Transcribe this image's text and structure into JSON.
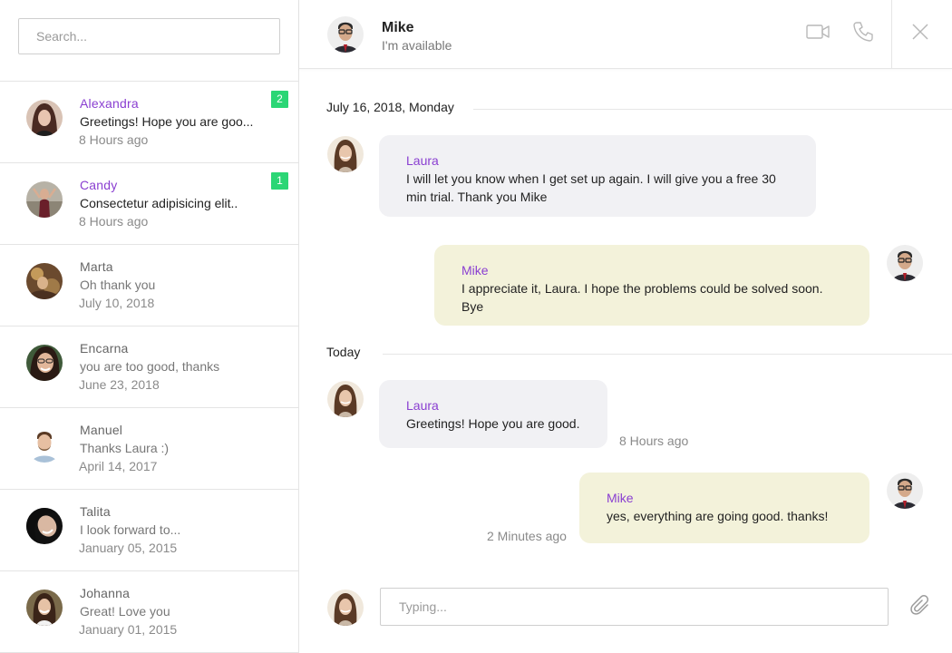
{
  "sidebar": {
    "search": {
      "placeholder": "Search..."
    },
    "contacts": [
      {
        "name": "Alexandra",
        "message": "Greetings! Hope you are goo...",
        "time": "8 Hours ago",
        "badge": "2",
        "unread": true,
        "avatar_color": "#5a3a32"
      },
      {
        "name": "Candy",
        "message": "Consectetur adipisicing elit..",
        "time": "8 Hours ago",
        "badge": "1",
        "unread": true,
        "avatar_color": "#8a6a5a"
      },
      {
        "name": "Marta",
        "message": "Oh thank you",
        "time": "July 10, 2018",
        "avatar_color": "#7a5a3a"
      },
      {
        "name": "Encarna",
        "message": "you are too good, thanks",
        "time": "June 23, 2018",
        "avatar_color": "#3a4a3a"
      },
      {
        "name": "Manuel",
        "message": "Thanks Laura :)",
        "time": "April 14, 2017",
        "avatar_color": "#b9a28a"
      },
      {
        "name": "Talita",
        "message": "I look forward to...",
        "time": "January 05, 2015",
        "avatar_color": "#1e1e1e"
      },
      {
        "name": "Johanna",
        "message": "Great! Love you",
        "time": "January 01, 2015",
        "avatar_color": "#6a4a3a"
      }
    ]
  },
  "header": {
    "name": "Mike",
    "status": "I'm available",
    "icons": {
      "video": "video-camera-icon",
      "phone": "phone-icon",
      "close": "close-icon"
    }
  },
  "conversation": {
    "date_1": "July 16, 2018, Monday",
    "date_2": "Today",
    "messages": [
      {
        "sender": "Laura",
        "text": "I will let you know when I get set up again. I will give you a free 30 min trial. Thank you Mike",
        "direction": "in"
      },
      {
        "sender": "Mike",
        "text": "I appreciate it, Laura. I hope the problems could be solved soon. Bye",
        "direction": "out"
      },
      {
        "sender": "Laura",
        "text": "Greetings! Hope you are good.",
        "time": "8 Hours ago",
        "direction": "in"
      },
      {
        "sender": "Mike",
        "text": "yes, everything are going good. thanks!",
        "time": "2 Minutes ago",
        "direction": "out"
      }
    ]
  },
  "composer": {
    "placeholder": "Typing...",
    "attach_icon": "paperclip-icon"
  },
  "colors": {
    "accent_name": "#8a3fd1",
    "badge": "#2bd675",
    "bubble_in": "#f1f1f4",
    "bubble_out": "#f3f2da"
  }
}
